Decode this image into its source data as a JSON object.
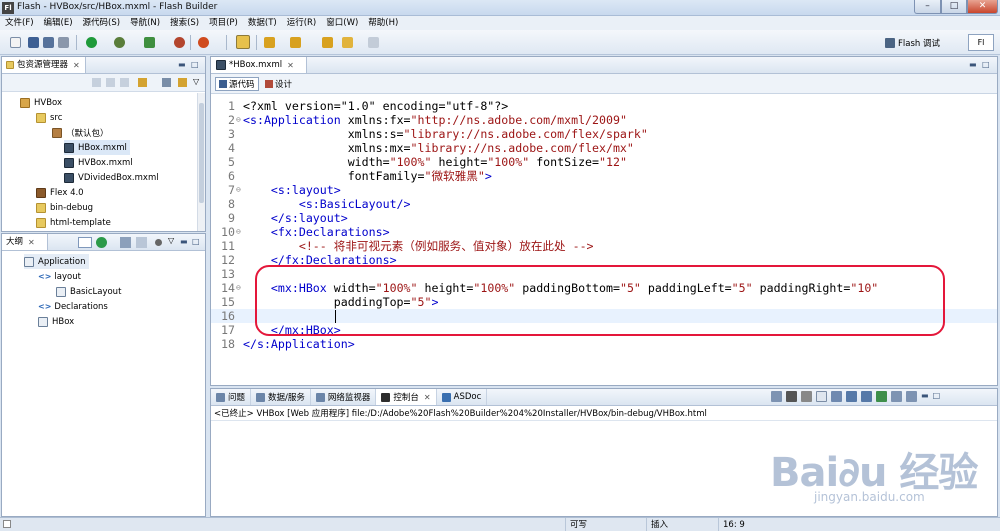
{
  "window": {
    "title": "Flash - HVBox/src/HBox.mxml - Flash Builder",
    "app_icon": "Fl",
    "minimize": "–",
    "maximize": "□",
    "close": "✕"
  },
  "menu": [
    "文件(F)",
    "编辑(E)",
    "源代码(S)",
    "导航(N)",
    "搜索(S)",
    "项目(P)",
    "数据(T)",
    "运行(R)",
    "窗口(W)",
    "帮助(H)"
  ],
  "toolbar": {
    "perspective_label": "Flash 调试",
    "flash_perspective_label": "Fl"
  },
  "package_explorer": {
    "tab_label": "包资源管理器",
    "close": "✕",
    "items": [
      {
        "label": "HVBox",
        "icon": "project-icon"
      },
      {
        "label": "src",
        "icon": "folder-icon"
      },
      {
        "label": "（默认包）",
        "icon": "package-icon"
      },
      {
        "label": "HBox.mxml",
        "icon": "mxml-file-icon"
      },
      {
        "label": "HVBox.mxml",
        "icon": "mxml-file-icon"
      },
      {
        "label": "VDividedBox.mxml",
        "icon": "mxml-file-icon"
      },
      {
        "label": "Flex 4.0",
        "icon": "sdk-library-icon"
      },
      {
        "label": "bin-debug",
        "icon": "folder-icon"
      },
      {
        "label": "html-template",
        "icon": "folder-icon"
      }
    ]
  },
  "outline": {
    "tab_label": "大纲",
    "close": "✕",
    "items": [
      {
        "label": "Application",
        "icon": "application-icon"
      },
      {
        "label": "layout",
        "icon": "property-icon"
      },
      {
        "label": "BasicLayout",
        "icon": "component-icon"
      },
      {
        "label": "Declarations",
        "icon": "property-icon"
      },
      {
        "label": "HBox",
        "icon": "component-icon"
      }
    ]
  },
  "editor": {
    "tab_label": "*HBox.mxml",
    "close": "✕",
    "mode_source": "源代码",
    "mode_design": "设计",
    "line_numbers": [
      "1",
      "2",
      "3",
      "4",
      "5",
      "6",
      "7",
      "8",
      "9",
      "10",
      "11",
      "12",
      "13",
      "14",
      "15",
      "16",
      "17",
      "18"
    ],
    "code": {
      "l1": "<?xml version=\"1.0\" encoding=\"utf-8\"?>",
      "l2_tag": "<s:Application",
      "l2_attr": " xmlns:fx=",
      "l2_val": "\"http://ns.adobe.com/mxml/2009\"",
      "l3_attr": "               xmlns:s=",
      "l3_val": "\"library://ns.adobe.com/flex/spark\"",
      "l4_attr": "               xmlns:mx=",
      "l4_val": "\"library://ns.adobe.com/flex/mx\"",
      "l5_attr1": "               width=",
      "l5_val1": "\"100%\"",
      "l5_attr2": " height=",
      "l5_val2": "\"100%\"",
      "l5_attr3": " fontSize=",
      "l5_val3": "\"12\"",
      "l6_attr": "               fontFamily=",
      "l6_val": "\"微软雅黑\"",
      "l6_end": ">",
      "l7": "    <s:layout>",
      "l8": "        <s:BasicLayout/>",
      "l9": "    </s:layout>",
      "l10": "    <fx:Declarations>",
      "l11": "        <!-- 将非可视元素（例如服务、值对象）放在此处 -->",
      "l12": "    </fx:Declarations>",
      "l14_tag": "    <mx:HBox",
      "l14_a1": " width=",
      "l14_v1": "\"100%\"",
      "l14_a2": " height=",
      "l14_v2": "\"100%\"",
      "l14_a3": " paddingBottom=",
      "l14_v3": "\"5\"",
      "l14_a4": " paddingLeft=",
      "l14_v4": "\"5\"",
      "l14_a5": " paddingRight=",
      "l14_v5": "\"10\"",
      "l15_a": "             paddingTop=",
      "l15_v": "\"5\"",
      "l15_end": ">",
      "l17": "    </mx:HBox>",
      "l18": "</s:Application>"
    }
  },
  "console": {
    "tabs": [
      "问题",
      "数据/服务",
      "网络监视器",
      "控制台",
      "ASDoc"
    ],
    "active_tab": "控制台",
    "status": "<已终止> VHBox [Web 应用程序] file:/D:/Adobe%20Flash%20Builder%204%20Installer/HVBox/bin-debug/VHBox.html"
  },
  "statusbar": {
    "writable": "可写",
    "insert_mode": "插入",
    "position": "16: 9"
  },
  "watermark": {
    "logo": "Bai∂u 经验",
    "sub": "jingyan.baidu.com"
  },
  "colors": {
    "tag": "#0000cc",
    "string": "#9c1414",
    "highlight": "#e4173a",
    "chrome": "#d9e4f1"
  }
}
